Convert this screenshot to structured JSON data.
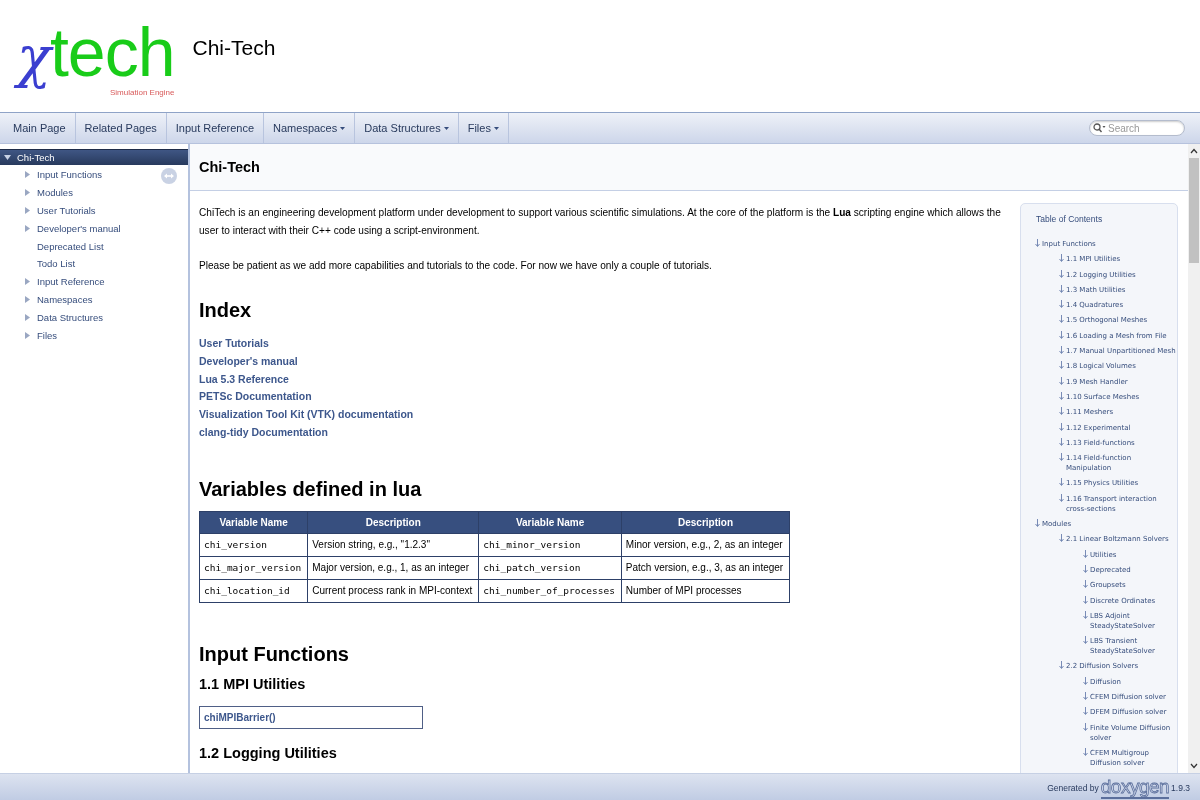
{
  "header": {
    "logo": {
      "symbol": "χ",
      "word": "tech",
      "tagline": "Simulation Engine"
    },
    "project_name": "Chi-Tech"
  },
  "menu": [
    {
      "label": "Main Page",
      "dropdown": false
    },
    {
      "label": "Related Pages",
      "dropdown": false
    },
    {
      "label": "Input Reference",
      "dropdown": false
    },
    {
      "label": "Namespaces",
      "dropdown": true
    },
    {
      "label": "Data Structures",
      "dropdown": true
    },
    {
      "label": "Files",
      "dropdown": true
    }
  ],
  "search": {
    "placeholder": "Search"
  },
  "sidebar": {
    "items": [
      {
        "label": "Chi-Tech",
        "selected": true,
        "expandable": true,
        "expanded": true,
        "children": [
          {
            "label": "Input Functions",
            "selected": false,
            "expandable": true,
            "expanded": false
          },
          {
            "label": "Modules",
            "selected": false,
            "expandable": true,
            "expanded": false
          },
          {
            "label": "User Tutorials",
            "selected": false,
            "expandable": true,
            "expanded": false
          },
          {
            "label": "Developer's manual",
            "selected": false,
            "expandable": true,
            "expanded": false
          },
          {
            "label": "Deprecated List",
            "selected": false,
            "expandable": false,
            "expanded": false
          },
          {
            "label": "Todo List",
            "selected": false,
            "expandable": false,
            "expanded": false
          },
          {
            "label": "Input Reference",
            "selected": false,
            "expandable": true,
            "expanded": false
          },
          {
            "label": "Namespaces",
            "selected": false,
            "expandable": true,
            "expanded": false
          },
          {
            "label": "Data Structures",
            "selected": false,
            "expandable": true,
            "expanded": false
          },
          {
            "label": "Files",
            "selected": false,
            "expandable": true,
            "expanded": false
          }
        ]
      }
    ]
  },
  "page": {
    "title": "Chi-Tech",
    "paragraphs": [
      "ChiTech is an engineering development platform under development to support various scientific simulations. At the core of the platform is the **Lua** scripting engine which allows the user to interact with their C++ code using a script-environment.",
      "Please be patient as we add more capabilities and tutorials to the code. For now we have only a couple of tutorials."
    ],
    "index_heading": "Index",
    "index_links": [
      "User Tutorials",
      "Developer's manual",
      "Lua 5.3 Reference",
      "PETSc Documentation",
      "Visualization Tool Kit (VTK) documentation",
      "clang-tidy Documentation"
    ],
    "variables_heading": "Variables defined in lua",
    "table": {
      "columns": [
        "Variable Name",
        "Description",
        "Variable Name",
        "Description"
      ],
      "rows": [
        [
          "chi_version",
          "Version string, e.g., \"1.2.3\"",
          "chi_minor_version",
          "Minor version, e.g., 2, as an integer"
        ],
        [
          "chi_major_version",
          "Major version, e.g., 1, as an integer",
          "chi_patch_version",
          "Patch version, e.g., 3, as an integer"
        ],
        [
          "chi_location_id",
          "Current process rank in MPI-context",
          "chi_number_of_processes",
          "Number of MPI processes"
        ]
      ]
    },
    "input_functions_heading": "Input Functions",
    "sections": [
      {
        "heading": "1.1 MPI Utilities",
        "functions": [
          "chiMPIBarrier()"
        ]
      },
      {
        "heading": "1.2 Logging Utilities"
      }
    ]
  },
  "toc": {
    "title": "Table of Contents",
    "items": [
      {
        "label": "Input Functions",
        "children": [
          {
            "label": "1.1 MPI Utilities"
          },
          {
            "label": "1.2 Logging Utilities"
          },
          {
            "label": "1.3 Math Utilities"
          },
          {
            "label": "1.4 Quadratures"
          },
          {
            "label": "1.5 Orthogonal Meshes"
          },
          {
            "label": "1.6 Loading a Mesh from File"
          },
          {
            "label": "1.7 Manual Unpartitioned Mesh"
          },
          {
            "label": "1.8 Logical Volumes"
          },
          {
            "label": "1.9 Mesh Handler"
          },
          {
            "label": "1.10 Surface Meshes"
          },
          {
            "label": "1.11 Meshers"
          },
          {
            "label": "1.12 Experimental"
          },
          {
            "label": "1.13 Field-functions"
          },
          {
            "label": "1.14 Field-function Manipulation"
          },
          {
            "label": "1.15 Physics Utilities"
          },
          {
            "label": "1.16 Transport interaction cross-sections"
          }
        ]
      },
      {
        "label": "Modules",
        "children": [
          {
            "label": "2.1 Linear Boltzmann Solvers",
            "children": [
              {
                "label": "Utilities"
              },
              {
                "label": "Deprecated"
              },
              {
                "label": "Groupsets"
              },
              {
                "label": "Discrete Ordinates"
              },
              {
                "label": "LBS Adjoint SteadyStateSolver"
              },
              {
                "label": "LBS Transient SteadyStateSolver"
              }
            ]
          },
          {
            "label": "2.2 Diffusion Solvers",
            "children": [
              {
                "label": "Diffusion"
              },
              {
                "label": "CFEM Diffusion solver"
              },
              {
                "label": "DFEM Diffusion solver"
              },
              {
                "label": "Finite Volume Diffusion solver"
              },
              {
                "label": "CFEM Multigroup Diffusion solver"
              }
            ]
          }
        ]
      }
    ]
  },
  "footer": {
    "generated_by": "Generated by",
    "tool": "doxygen",
    "version": "1.9.3"
  }
}
